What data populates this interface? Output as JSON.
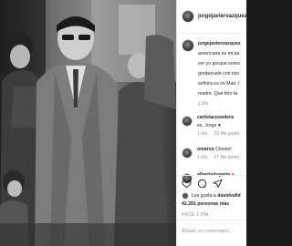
{
  "post": {
    "username": "jorgejaviervazquez",
    "caption_username": "jorgejaviervazquez",
    "caption_lines": [
      "americana es mi pa",
      "ser yo porque somo",
      "gordezuelo con rizo",
      "señora es mi Mari. I",
      "madre. Qué foto ta"
    ],
    "caption_time": "1 día"
  },
  "comments": [
    {
      "username": "carlotaconedera",
      "text": "✓",
      "extra": "es, Jorge ♥",
      "time": "1 día",
      "likes": "33 Me gusta",
      "reply": "Re"
    },
    {
      "username": "omarsu",
      "text": "Clones!",
      "time": "1 día",
      "likes": "27 Me gusta",
      "reply": ""
    },
    {
      "username": "albertodugarte",
      "text": "♥"
    }
  ],
  "likes": {
    "liked_by_prefix": "Les gusta a",
    "liked_by_user": "davidvalld",
    "count_prefix": "",
    "count": "42.281 personas más",
    "time_ago": "HACE 1 DÍA"
  },
  "add_comment_placeholder": "Añade un comentario..."
}
